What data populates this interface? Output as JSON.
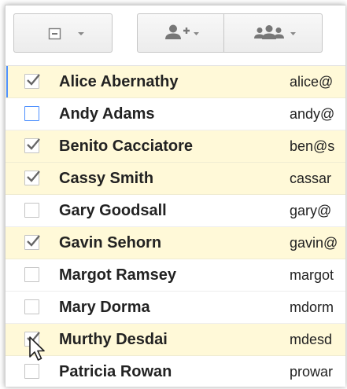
{
  "toolbar": {
    "select_button": {
      "icon": "select-all-checkbox-icon",
      "menu_icon": "caret-down-icon"
    },
    "add_to_circles_button": {
      "icon": "add-person-icon",
      "menu_icon": "caret-down-icon"
    },
    "group_button": {
      "icon": "people-group-icon",
      "menu_icon": "caret-down-icon"
    }
  },
  "contacts": [
    {
      "name": "Alice Abernathy",
      "email": "alice@",
      "checked": true,
      "focused": true
    },
    {
      "name": "Andy Adams",
      "email": "andy@",
      "checked": false,
      "hovered": true
    },
    {
      "name": "Benito Cacciatore",
      "email": "ben@s",
      "checked": true
    },
    {
      "name": "Cassy Smith",
      "email": "cassar",
      "checked": true
    },
    {
      "name": "Gary Goodsall",
      "email": "gary@",
      "checked": false
    },
    {
      "name": "Gavin Sehorn",
      "email": "gavin@",
      "checked": true
    },
    {
      "name": "Margot Ramsey",
      "email": "margot",
      "checked": false
    },
    {
      "name": "Mary Dorma",
      "email": "mdorm",
      "checked": false
    },
    {
      "name": "Murthy Desdai",
      "email": "mdesd",
      "checked": true
    },
    {
      "name": "Patricia Rowan",
      "email": "prowar",
      "checked": false
    }
  ],
  "colors": {
    "selected_row": "#fff9d8",
    "focus_accent": "#4d90fe",
    "checkmark": "#666666"
  }
}
